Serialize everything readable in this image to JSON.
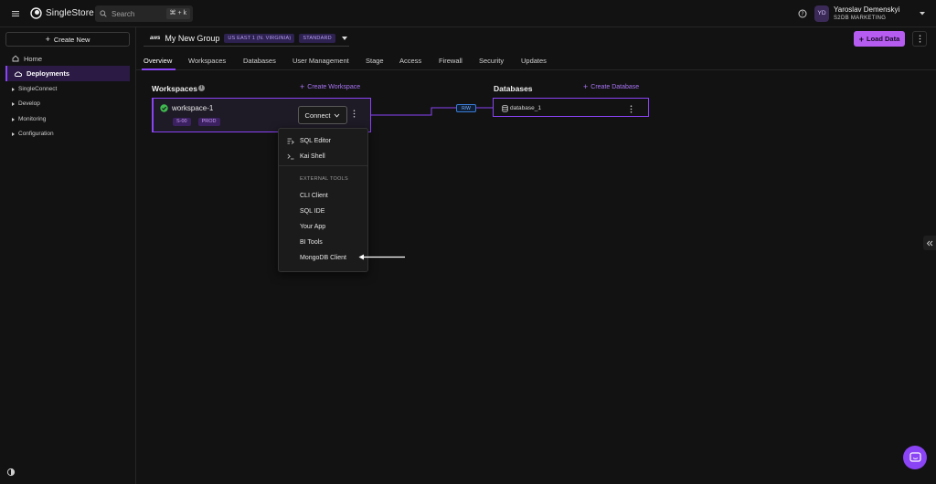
{
  "header": {
    "logo_text": "SingleStore",
    "search_placeholder": "Search",
    "search_shortcut": "⌘ + k",
    "user_initials": "YD",
    "user_name": "Yaroslav Demenskyi",
    "user_org": "S2DB MARKETING"
  },
  "sidebar": {
    "create_new": "Create New",
    "items": [
      {
        "label": "Home",
        "icon": "home-icon"
      },
      {
        "label": "Deployments",
        "icon": "cloud-icon",
        "active": true
      }
    ],
    "groups": [
      "SingleConnect",
      "Develop",
      "Monitoring",
      "Configuration"
    ]
  },
  "group": {
    "provider": "aws",
    "name": "My New Group",
    "region": "US EAST 1 (N. VIRGINIA)",
    "tier": "STANDARD",
    "load_data": "Load Data"
  },
  "tabs": [
    "Overview",
    "Workspaces",
    "Databases",
    "User Management",
    "Stage",
    "Access",
    "Firewall",
    "Security",
    "Updates"
  ],
  "active_tab": "Overview",
  "workspaces": {
    "title": "Workspaces",
    "create_label": "Create Workspace",
    "card": {
      "name": "workspace-1",
      "size": "S-00",
      "env": "PROD",
      "status": "running",
      "connect_label": "Connect"
    }
  },
  "databases": {
    "title": "Databases",
    "create_label": "Create Database",
    "items": [
      {
        "name": "database_1",
        "access": "R/W"
      }
    ]
  },
  "connect_menu": {
    "items": [
      {
        "label": "SQL Editor",
        "icon": "sql-editor-icon"
      },
      {
        "label": "Kai Shell",
        "icon": "terminal-icon"
      }
    ],
    "section_label": "EXTERNAL TOOLS",
    "external": [
      "CLI Client",
      "SQL IDE",
      "Your App",
      "BI Tools",
      "MongoDB Client"
    ]
  },
  "colors": {
    "accent": "#8a43f5",
    "button_primary": "#b65cf0",
    "success": "#3fb950",
    "rw_blue": "#3a7bd5"
  }
}
